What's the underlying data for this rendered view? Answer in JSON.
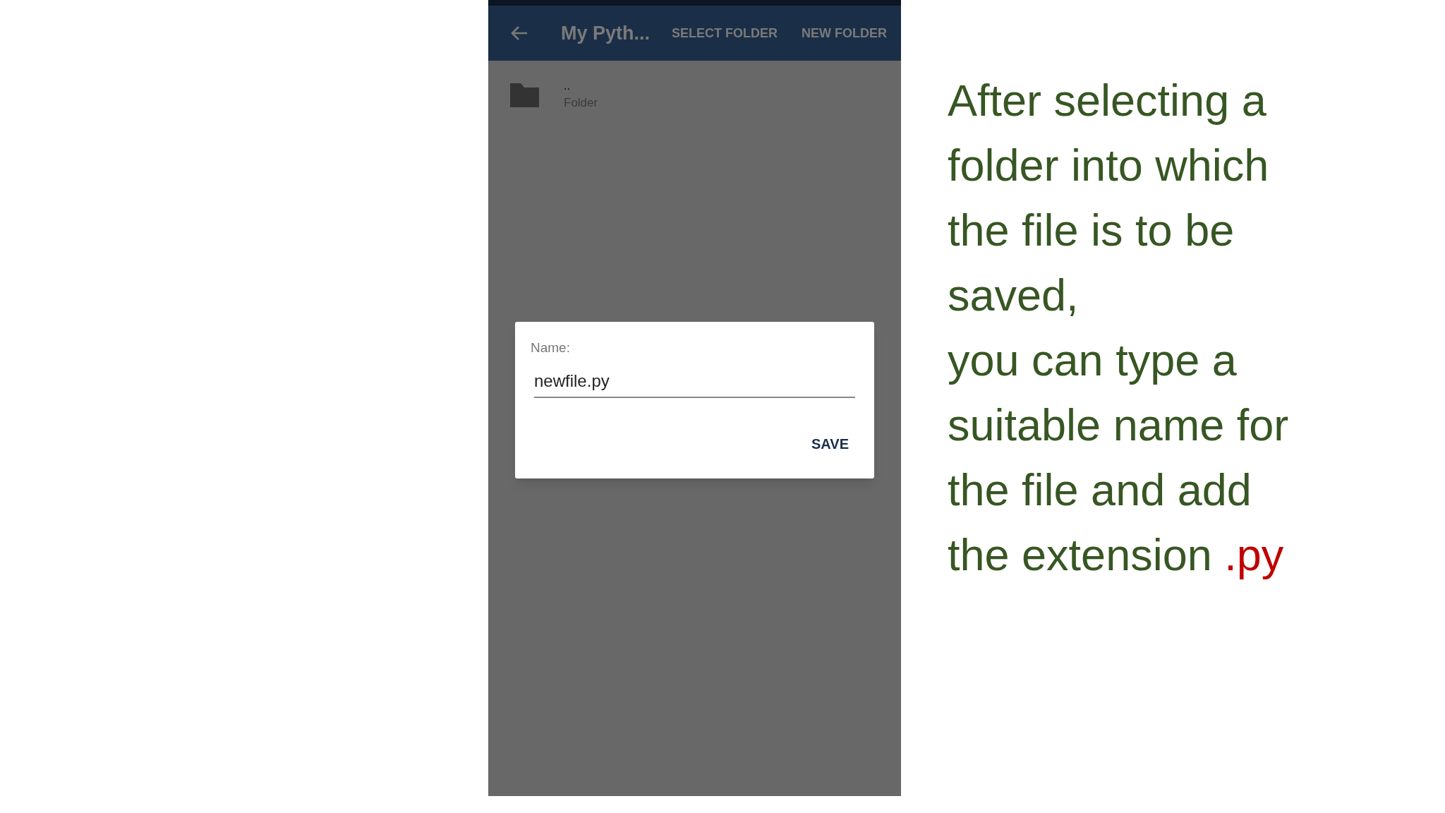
{
  "app_bar": {
    "title": "My Pyth...",
    "actions": [
      "SELECT FOLDER",
      "NEW FOLDER"
    ]
  },
  "files": [
    {
      "name": "..",
      "type": "Folder"
    }
  ],
  "dialog": {
    "label": "Name:",
    "value": "newfile.py",
    "button": "SAVE"
  },
  "caption": {
    "lines": [
      "After selecting a",
      "folder into which",
      "the file is to be",
      "saved,",
      "you can type a",
      "suitable name for",
      "the file and add",
      "the extension "
    ],
    "highlight": ".py"
  }
}
